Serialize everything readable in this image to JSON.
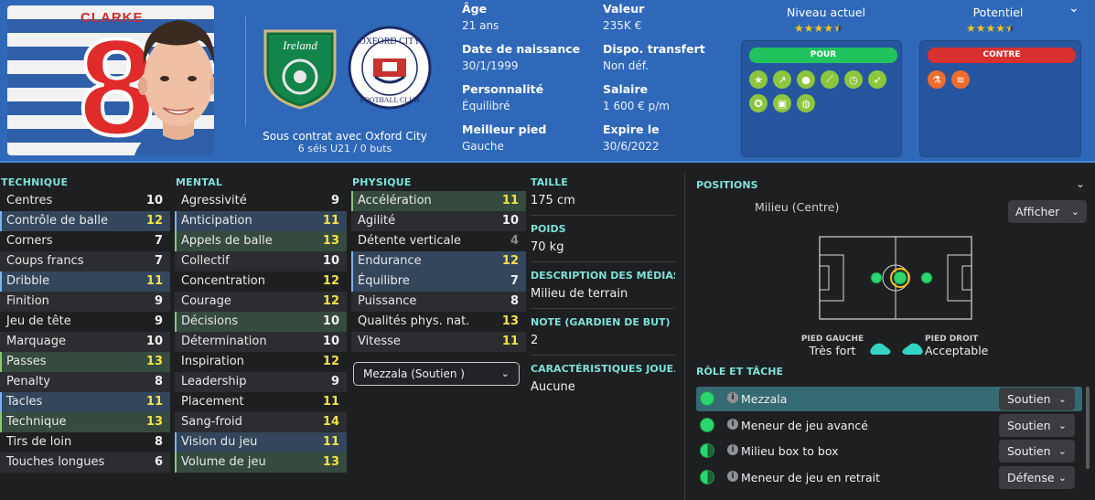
{
  "header": {
    "kit_name": "CLARKE",
    "kit_number": "8",
    "contract_line1": "Sous contrat avec Oxford City",
    "contract_line2": "6 séls U21 / 0 buts",
    "badges": [
      "Ireland",
      "Oxford City Football Club"
    ],
    "info_left": [
      {
        "label": "Âge",
        "value": "21 ans"
      },
      {
        "label": "Date de naissance",
        "value": "30/1/1999"
      },
      {
        "label": "Personnalité",
        "value": "Équilibré"
      },
      {
        "label": "Meilleur pied",
        "value": "Gauche"
      }
    ],
    "info_right": [
      {
        "label": "Valeur",
        "value": "235K €"
      },
      {
        "label": "Dispo. transfert",
        "value": "Non déf."
      },
      {
        "label": "Salaire",
        "value": "1 600 € p/m"
      },
      {
        "label": "Expire le",
        "value": "30/6/2022"
      }
    ],
    "current_ability_label": "Niveau actuel",
    "potential_label": "Potentiel",
    "current_ability_stars": 4.5,
    "potential_stars": 4.5,
    "pour_label": "POUR",
    "contre_label": "CONTRE",
    "pour_icons": [
      "star-icon",
      "trend-icon",
      "head-icon",
      "boot-icon",
      "clock-icon",
      "pass-icon",
      "brain-icon",
      "fitness-icon",
      "globe-icon"
    ],
    "contre_icons": [
      "flask-icon",
      "spring-icon"
    ],
    "colors": {
      "header_bg": "#2f68b8",
      "pour": "#22c35e",
      "contre": "#d93030",
      "accent": "#7ee2d9"
    }
  },
  "attributes": {
    "technique": {
      "title": "TECHNIQUE",
      "rows": [
        {
          "name": "Centres",
          "value": "10"
        },
        {
          "name": "Contrôle de balle",
          "value": "12"
        },
        {
          "name": "Corners",
          "value": "7"
        },
        {
          "name": "Coups francs",
          "value": "7"
        },
        {
          "name": "Dribble",
          "value": "11"
        },
        {
          "name": "Finition",
          "value": "9"
        },
        {
          "name": "Jeu de tête",
          "value": "9"
        },
        {
          "name": "Marquage",
          "value": "10"
        },
        {
          "name": "Passes",
          "value": "13"
        },
        {
          "name": "Penalty",
          "value": "8"
        },
        {
          "name": "Tacles",
          "value": "11"
        },
        {
          "name": "Technique",
          "value": "13"
        },
        {
          "name": "Tirs de loin",
          "value": "8"
        },
        {
          "name": "Touches longues",
          "value": "6"
        }
      ]
    },
    "mental": {
      "title": "MENTAL",
      "rows": [
        {
          "name": "Agressivité",
          "value": "9"
        },
        {
          "name": "Anticipation",
          "value": "11"
        },
        {
          "name": "Appels de balle",
          "value": "13"
        },
        {
          "name": "Collectif",
          "value": "10"
        },
        {
          "name": "Concentration",
          "value": "12"
        },
        {
          "name": "Courage",
          "value": "12"
        },
        {
          "name": "Décisions",
          "value": "10"
        },
        {
          "name": "Détermination",
          "value": "10"
        },
        {
          "name": "Inspiration",
          "value": "12"
        },
        {
          "name": "Leadership",
          "value": "9"
        },
        {
          "name": "Placement",
          "value": "11"
        },
        {
          "name": "Sang-froid",
          "value": "14"
        },
        {
          "name": "Vision du jeu",
          "value": "11"
        },
        {
          "name": "Volume de jeu",
          "value": "13"
        }
      ]
    },
    "physique": {
      "title": "PHYSIQUE",
      "rows": [
        {
          "name": "Accélération",
          "value": "11"
        },
        {
          "name": "Agilité",
          "value": "10"
        },
        {
          "name": "Détente verticale",
          "value": "4"
        },
        {
          "name": "Endurance",
          "value": "12"
        },
        {
          "name": "Équilibre",
          "value": "7"
        },
        {
          "name": "Puissance",
          "value": "8"
        },
        {
          "name": "Qualités phys. nat.",
          "value": "13"
        },
        {
          "name": "Vitesse",
          "value": "11"
        }
      ]
    }
  },
  "role_select": {
    "value": "Mezzala (Soutien )"
  },
  "details": [
    {
      "label": "TAILLE",
      "value": "175 cm"
    },
    {
      "label": "POIDS",
      "value": "70 kg"
    },
    {
      "label": "DESCRIPTION DES MÉDIAS",
      "value": "Milieu de terrain"
    },
    {
      "label": "NOTE (GARDIEN DE BUT)",
      "value": "2"
    },
    {
      "label": "CARACTÉRISTIQUES JOUE...",
      "value": "Aucune"
    }
  ],
  "positions": {
    "title": "POSITIONS",
    "position_name": "Milieu (Centre)",
    "afficher_label": "Afficher",
    "left_foot_label": "PIED GAUCHE",
    "left_foot_value": "Très fort",
    "right_foot_label": "PIED DROIT",
    "right_foot_value": "Acceptable"
  },
  "roles": {
    "title": "RÔLE ET TÂCHE",
    "rows": [
      {
        "name": "Mezzala",
        "duty": "Soutien"
      },
      {
        "name": "Meneur de jeu avancé",
        "duty": "Soutien"
      },
      {
        "name": "Milieu box to box",
        "duty": "Soutien"
      },
      {
        "name": "Meneur de jeu en retrait",
        "duty": "Défense"
      }
    ]
  }
}
